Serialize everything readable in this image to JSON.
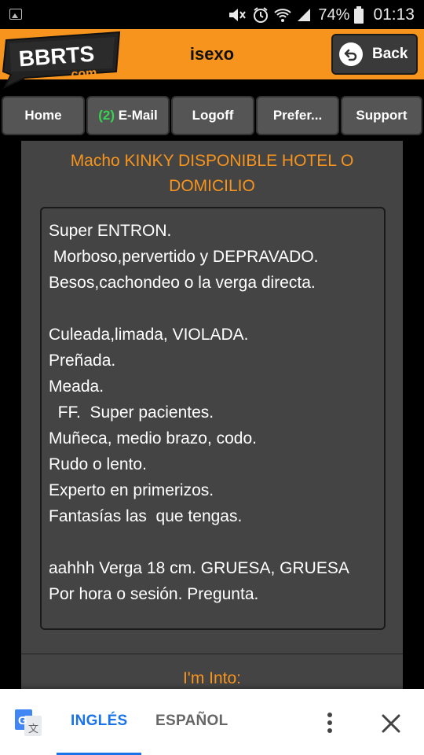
{
  "status_bar": {
    "battery": "74%",
    "time": "01:13",
    "icons": [
      "image-icon",
      "mute-icon",
      "alarm-icon",
      "wifi-icon",
      "signal-icon",
      "battery-icon"
    ]
  },
  "header": {
    "logo_text": "BBRTS",
    "logo_subtext": ".com",
    "title": "isexo",
    "back_label": "Back",
    "colors": {
      "bar": "#f7941d",
      "button": "#3a3a3a"
    }
  },
  "nav": {
    "home": "Home",
    "email_count": "(2)",
    "email_label": "E-Mail",
    "logoff": "Logoff",
    "preferences": "Prefer...",
    "support": "Support"
  },
  "post": {
    "title": "Macho KINKY DISPONIBLE HOTEL O DOMICILIO",
    "lines": [
      "Super ENTRON.",
      " Morboso,pervertido y DEPRAVADO.",
      "Besos,cachondeo o la verga directa.",
      "",
      "Culeada,limada, VIOLADA.",
      "Preñada.",
      "Meada.",
      "  FF.  Super pacientes.",
      "Muñeca, medio brazo, codo.",
      "Rudo o lento.",
      "Experto en primerizos.",
      "Fantasías las  que tengas.",
      "",
      "aahhh Verga 18 cm. GRUESA, GRUESA",
      "Por hora o sesión. Pregunta."
    ],
    "into_label": "I'm Into:",
    "accent_color": "#f7941d"
  },
  "translate_bar": {
    "active_lang": "INGLÉS",
    "inactive_lang": "ESPAÑOL",
    "active_color": "#1a73e8"
  }
}
